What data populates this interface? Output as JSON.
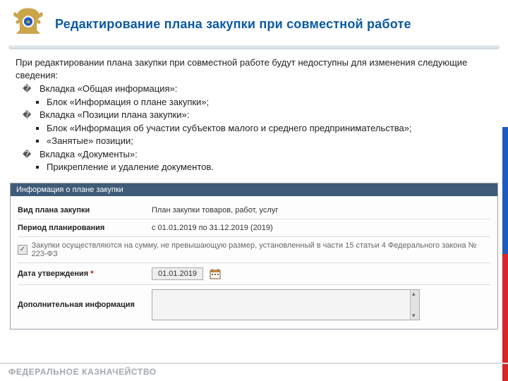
{
  "header": {
    "title": "Редактирование плана закупки при совместной работе"
  },
  "intro": "При редактировании плана закупки при совместной работе будут недоступны для изменения следующие сведения:",
  "bullets": {
    "tab1": "Вкладка «Общая информация»:",
    "tab1_items": [
      "Блок «Информация о плане закупки»;"
    ],
    "tab2": "Вкладка «Позиции плана закупки»:",
    "tab2_items": [
      "Блок «Информация об участии субъектов малого и среднего предпринимательства»;",
      "«Занятые» позиции;"
    ],
    "tab3": "Вкладка «Документы»:",
    "tab3_items": [
      "Прикрепление и удаление документов."
    ]
  },
  "panel": {
    "title": "Информация о плане закупки",
    "rows": {
      "type_label": "Вид плана закупки",
      "type_value": "План закупки товаров, работ, услуг",
      "period_label": "Период планирования",
      "period_value": "с 01.01.2019 по 31.12.2019 (2019)",
      "checkbox_text": "Закупки осуществляются на сумму, не превышающую размер, установленный в части 15 статьи 4 Федерального закона № 223-ФЗ",
      "approve_label": "Дата утверждения",
      "approve_value": "01.01.2019",
      "notes_label": "Дополнительная информация"
    }
  },
  "footer": "ФЕДЕРАЛЬНОЕ КАЗНАЧЕЙСТВО"
}
